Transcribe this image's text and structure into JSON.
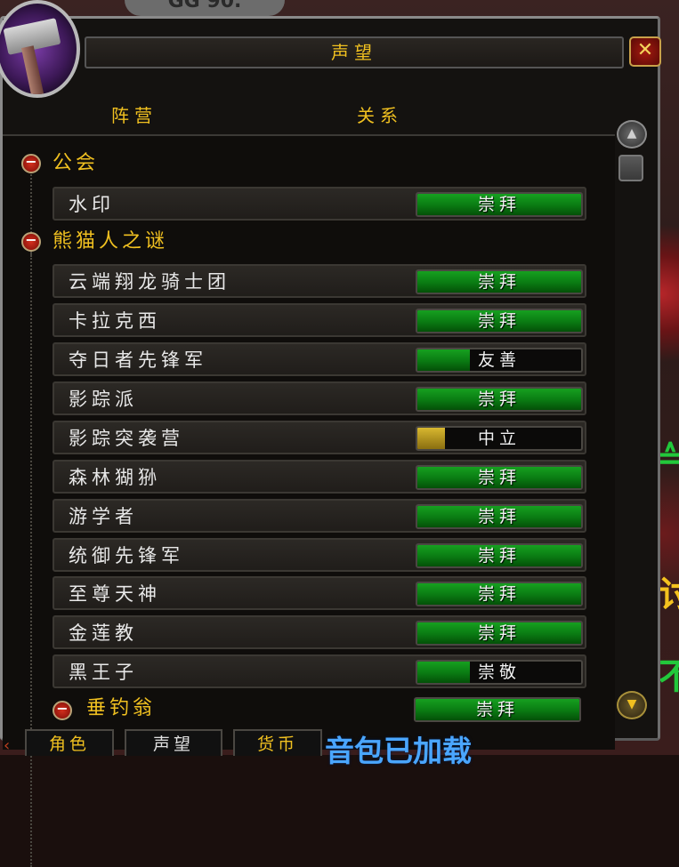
{
  "window": {
    "title": "声望",
    "close_label": "✕"
  },
  "columns": {
    "faction": "阵营",
    "relation": "关系"
  },
  "groups": [
    {
      "name": "公会",
      "rows": [
        {
          "name": "水印",
          "standing": "崇拜",
          "fill": 1.0,
          "color": "#0a7a12"
        }
      ]
    },
    {
      "name": "熊猫人之谜",
      "rows": [
        {
          "name": "云端翔龙骑士团",
          "standing": "崇拜",
          "fill": 1.0,
          "color": "#0a7a12"
        },
        {
          "name": "卡拉克西",
          "standing": "崇拜",
          "fill": 1.0,
          "color": "#0a7a12"
        },
        {
          "name": "夺日者先锋军",
          "standing": "友善",
          "fill": 0.32,
          "color": "#0a7a12"
        },
        {
          "name": "影踪派",
          "standing": "崇拜",
          "fill": 1.0,
          "color": "#0a7a12"
        },
        {
          "name": "影踪突袭营",
          "standing": "中立",
          "fill": 0.17,
          "color": "#b89a18"
        },
        {
          "name": "森林猢狲",
          "standing": "崇拜",
          "fill": 1.0,
          "color": "#0a7a12"
        },
        {
          "name": "游学者",
          "standing": "崇拜",
          "fill": 1.0,
          "color": "#0a7a12"
        },
        {
          "name": "统御先锋军",
          "standing": "崇拜",
          "fill": 1.0,
          "color": "#0a7a12"
        },
        {
          "name": "至尊天神",
          "standing": "崇拜",
          "fill": 1.0,
          "color": "#0a7a12"
        },
        {
          "name": "金莲教",
          "standing": "崇拜",
          "fill": 1.0,
          "color": "#0a7a12"
        },
        {
          "name": "黑王子",
          "standing": "崇敬",
          "fill": 0.32,
          "color": "#0a7a12"
        }
      ]
    }
  ],
  "subgroup": {
    "name": "垂钓翁",
    "standing": "崇拜",
    "fill": 1.0,
    "color": "#0a7a12"
  },
  "tabs": [
    "角色",
    "声望",
    "货币"
  ],
  "background": {
    "message": "音包已加载",
    "title_fragment": "GG 90."
  }
}
